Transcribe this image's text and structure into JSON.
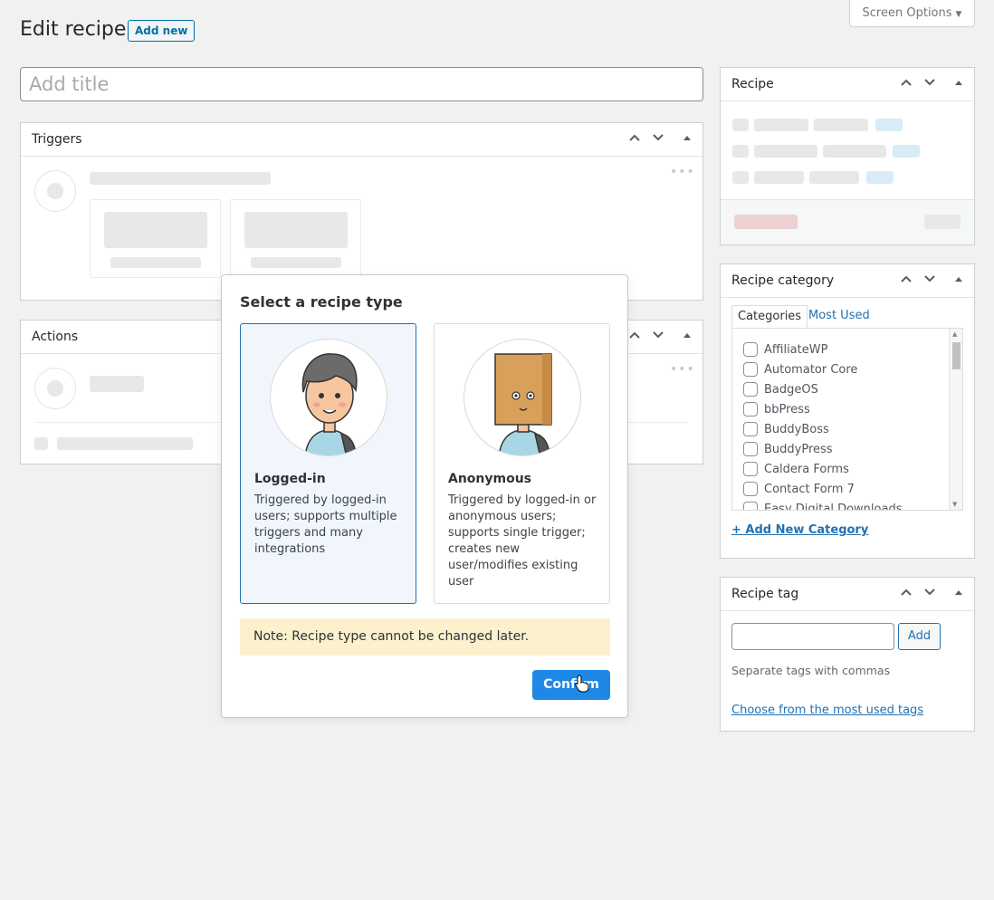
{
  "header": {
    "title": "Edit recipe",
    "add_new_label": "Add new",
    "screen_options_label": "Screen Options"
  },
  "title_field": {
    "placeholder": "Add title",
    "value": ""
  },
  "triggers_box": {
    "title": "Triggers"
  },
  "actions_box": {
    "title": "Actions"
  },
  "recipe_box": {
    "title": "Recipe"
  },
  "category_box": {
    "title": "Recipe category",
    "tabs": [
      "Categories",
      "Most Used"
    ],
    "items": [
      "AffiliateWP",
      "Automator Core",
      "BadgeOS",
      "bbPress",
      "BuddyBoss",
      "BuddyPress",
      "Caldera Forms",
      "Contact Form 7",
      "Easy Digital Downloads"
    ],
    "add_new_link": "+ Add New Category"
  },
  "tag_box": {
    "title": "Recipe tag",
    "add_label": "Add",
    "hint": "Separate tags with commas",
    "most_used_link": "Choose from the most used tags",
    "input_value": ""
  },
  "modal": {
    "title": "Select a recipe type",
    "options": [
      {
        "name": "Logged-in",
        "description": "Triggered by logged-in users; supports multiple triggers and many integrations",
        "selected": true
      },
      {
        "name": "Anonymous",
        "description": "Triggered by logged-in or anonymous users; supports single trigger; creates new user/modifies existing user",
        "selected": false
      }
    ],
    "note": "Note: Recipe type cannot be changed later.",
    "confirm_label": "Confirm"
  },
  "colors": {
    "primary_button": "#1e88e5",
    "selected_card_bg": "#f0f6fc",
    "note_bg": "#fcf0cd",
    "link": "#2271b1"
  },
  "icons": [
    "chevron-up-icon",
    "chevron-down-icon",
    "collapse-triangle-icon",
    "more-dots-icon",
    "pointer-cursor-icon"
  ]
}
